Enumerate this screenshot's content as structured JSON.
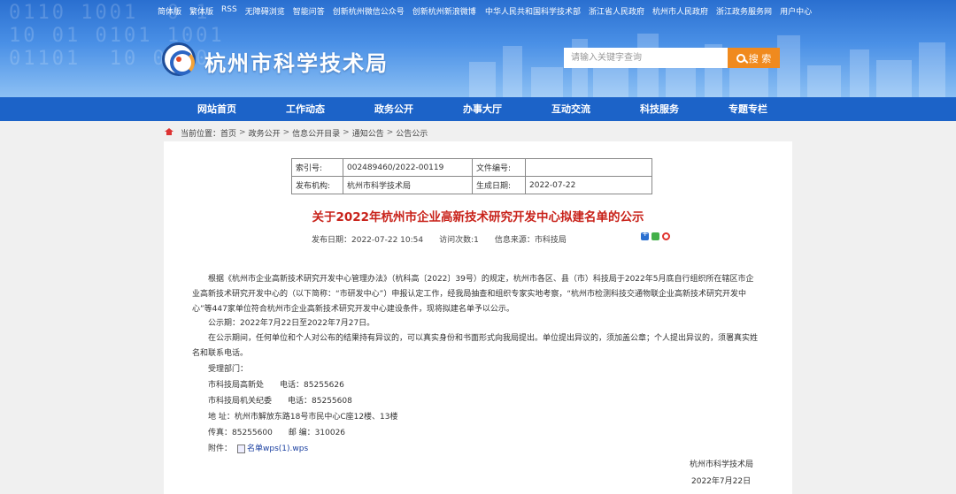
{
  "topbar": {
    "left_links": [
      "简体版",
      "繁体版",
      "RSS",
      "无障碍浏览",
      "智能问答",
      "创新杭州微信公众号",
      "创新杭州新浪微博"
    ],
    "right_links": [
      "中华人民共和国科学技术部",
      "浙江省人民政府",
      "杭州市人民政府",
      "浙江政务服务网",
      "用户中心"
    ]
  },
  "header": {
    "site_title": "杭州市科学技术局",
    "search_placeholder": "请输入关键字查询",
    "search_button": "搜 索"
  },
  "nav": {
    "items": [
      "网站首页",
      "工作动态",
      "政务公开",
      "办事大厅",
      "互动交流",
      "科技服务",
      "专题专栏"
    ]
  },
  "breadcrumb": {
    "prefix": "当前位置：",
    "items": [
      "首页",
      "政务公开",
      "信息公开目录",
      "通知公告",
      "公告公示"
    ],
    "separator": ">"
  },
  "meta_table": {
    "index_label": "索引号:",
    "index_value": "002489460/2022-00119",
    "docno_label": "文件编号:",
    "docno_value": "",
    "publisher_label": "发布机构:",
    "publisher_value": "杭州市科学技术局",
    "created_label": "生成日期:",
    "created_value": "2022-07-22"
  },
  "article": {
    "title": "关于2022年杭州市企业高新技术研究开发中心拟建名单的公示",
    "publish_date": "发布日期：2022-07-22 10:54",
    "visits": "访问次数:1",
    "source": "信息来源：市科技局",
    "para1": "根据《杭州市企业高新技术研究开发中心管理办法》（杭科高〔2022〕39号）的规定，杭州市各区、县（市）科技局于2022年5月底自行组织所在辖区市企业高新技术研究开发中心的（以下简称：“市研发中心”）申报认定工作，经我局抽查和组织专家实地考察，“杭州市检测科技交通物联企业高新技术研究开发中心”等447家单位符合杭州市企业高新技术研究开发中心建设条件，现将拟建名单予以公示。",
    "para2": "公示期：2022年7月22日至2022年7月27日。",
    "para3": "在公示期间，任何单位和个人对公布的结果持有异议的，可以真实身份和书面形式向我局提出。单位提出异议的，须加盖公章；个人提出异议的，须署真实姓名和联系电话。",
    "contacts": {
      "dept_label": "受理部门：",
      "dept1_name": "市科技局高新处",
      "dept1_phone": "电话：85255626",
      "dept2_name": "市科技局机关纪委",
      "dept2_phone": "电话：85255608",
      "address": "地 址：杭州市解放东路18号市民中心C座12楼、13楼",
      "fax": "传真：85255600",
      "postcode": "邮 编：310026",
      "attachment_label": "附件：",
      "attachment_name": "名单wps(1).wps"
    },
    "signature": "杭州市科学技术局",
    "sign_date": "2022年7月22日"
  }
}
